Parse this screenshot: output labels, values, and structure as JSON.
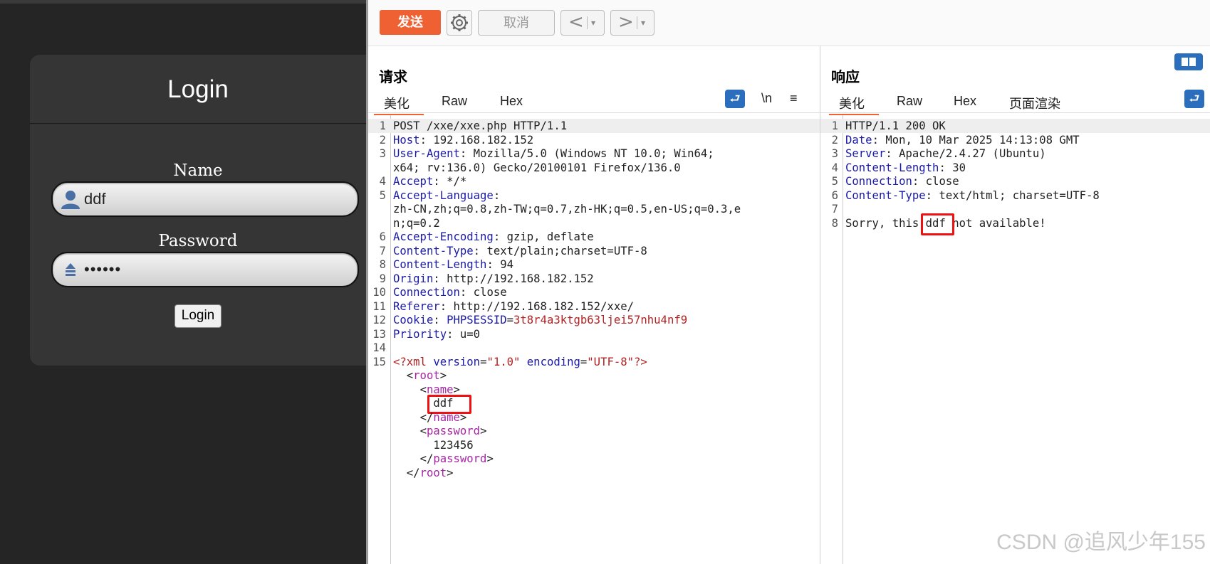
{
  "login": {
    "title": "Login",
    "name_label": "Name",
    "name_value": "ddf",
    "password_label": "Password",
    "password_value": "••••••",
    "button_label": "Login",
    "icons": [
      "user-icon",
      "lock-icon"
    ]
  },
  "toolbar": {
    "send_label": "发送",
    "cancel_label": "取消",
    "prev_label": "<",
    "next_label": ">",
    "dropdown_label": "▾",
    "send_color": "#ef6133"
  },
  "request": {
    "title": "请求",
    "tabs": [
      "美化",
      "Raw",
      "Hex"
    ],
    "tools": [
      "wrap-icon",
      "\\n",
      "≡"
    ],
    "lines": [
      {
        "n": "1",
        "k": "",
        "v": "POST /xxe/xxe.php HTTP/1.1"
      },
      {
        "n": "2",
        "k": "Host",
        "v": ": 192.168.182.152"
      },
      {
        "n": "3",
        "k": "User-Agent",
        "v": ": Mozilla/5.0 (Windows NT 10.0; Win64;"
      },
      {
        "n": "",
        "k": "",
        "v": "x64; rv:136.0) Gecko/20100101 Firefox/136.0"
      },
      {
        "n": "4",
        "k": "Accept",
        "v": ": */*"
      },
      {
        "n": "5",
        "k": "Accept-Language",
        "v": ":"
      },
      {
        "n": "",
        "k": "",
        "v": "zh-CN,zh;q=0.8,zh-TW;q=0.7,zh-HK;q=0.5,en-US;q=0.3,e"
      },
      {
        "n": "",
        "k": "",
        "v": "n;q=0.2"
      },
      {
        "n": "6",
        "k": "Accept-Encoding",
        "v": ": gzip, deflate"
      },
      {
        "n": "7",
        "k": "Content-Type",
        "v": ": text/plain;charset=UTF-8"
      },
      {
        "n": "8",
        "k": "Content-Length",
        "v": ": 94"
      },
      {
        "n": "9",
        "k": "Origin",
        "v": ": http://192.168.182.152"
      },
      {
        "n": "10",
        "k": "Connection",
        "v": ": close"
      },
      {
        "n": "11",
        "k": "Referer",
        "v": ": http://192.168.182.152/xxe/"
      },
      {
        "n": "12",
        "k": "Cookie",
        "v": ": "
      },
      {
        "n": "13",
        "k": "Priority",
        "v": ": u=0"
      },
      {
        "n": "14",
        "k": "",
        "v": ""
      },
      {
        "n": "15",
        "k": "",
        "v": ""
      }
    ],
    "cookie_name": "PHPSESSID",
    "cookie_value": "3t8r4a3ktgb63ljei57nhu4nf9",
    "xml": {
      "decl_open": "<?xml ",
      "version_attr": "version",
      "version_val": "\"1.0\"",
      "encoding_attr": "encoding",
      "encoding_val": "\"UTF-8\"",
      "decl_close": "?>",
      "root": "root",
      "name": "name",
      "name_value": "ddf",
      "password": "password",
      "password_value": "123456"
    }
  },
  "response": {
    "title": "响应",
    "tabs": [
      "美化",
      "Raw",
      "Hex",
      "页面渲染"
    ],
    "tools": [
      "wrap-icon"
    ],
    "lines": [
      {
        "n": "1",
        "k": "",
        "v": "HTTP/1.1 200 OK"
      },
      {
        "n": "2",
        "k": "Date",
        "v": ": Mon, 10 Mar 2025 14:13:08 GMT"
      },
      {
        "n": "3",
        "k": "Server",
        "v": ": Apache/2.4.27 (Ubuntu)"
      },
      {
        "n": "4",
        "k": "Content-Length",
        "v": ": 30"
      },
      {
        "n": "5",
        "k": "Connection",
        "v": ": close"
      },
      {
        "n": "6",
        "k": "Content-Type",
        "v": ": text/html; charset=UTF-8"
      },
      {
        "n": "7",
        "k": "",
        "v": ""
      }
    ],
    "body_line_num": "8",
    "body_prefix": "Sorry, this ",
    "body_highlight": "ddf",
    "body_suffix": " not available!"
  },
  "watermark": "CSDN @追风少年155"
}
